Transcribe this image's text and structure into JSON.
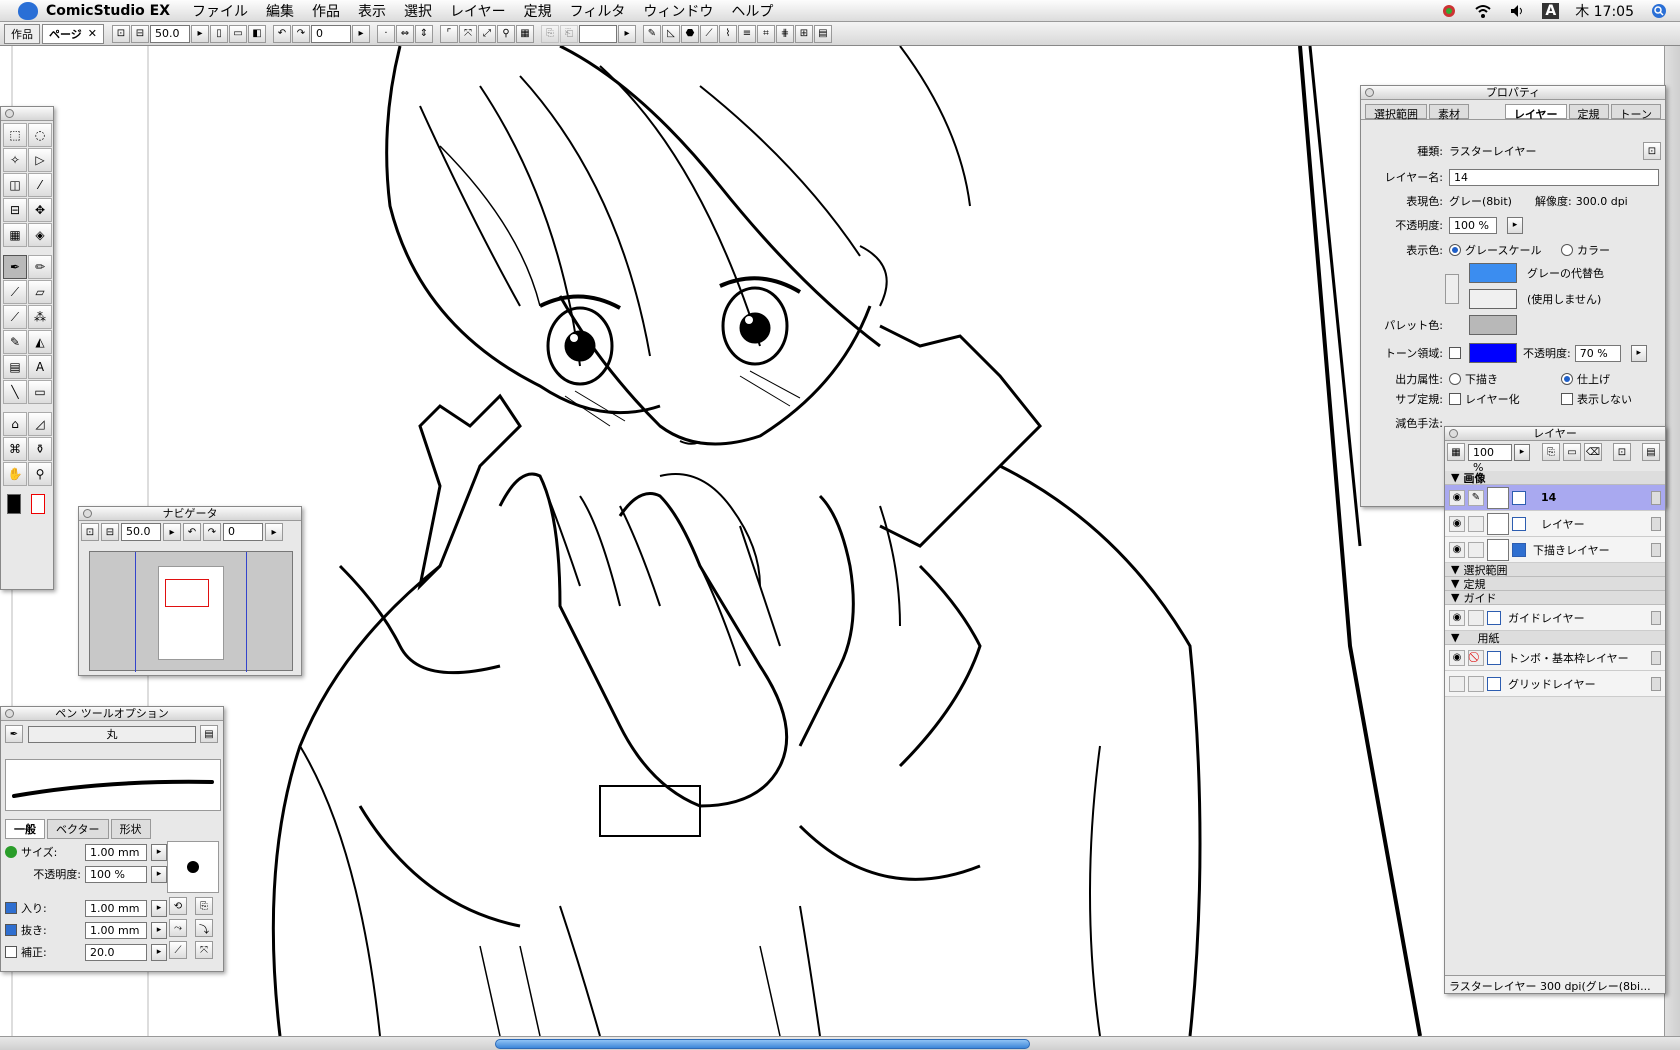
{
  "menubar": {
    "app_name": "ComicStudio EX",
    "items": [
      "ファイル",
      "編集",
      "作品",
      "表示",
      "選択",
      "レイヤー",
      "定規",
      "フィルタ",
      "ウィンドウ",
      "ヘルプ"
    ],
    "clock": "木 17:05",
    "ime": "A"
  },
  "toolbar": {
    "tab_work": "作品",
    "tab_page": "ページ",
    "tab_close": "✕",
    "zoom": "50.0",
    "angle": "0"
  },
  "toolbox": {
    "tools": [
      "marquee",
      "lasso",
      "magic-wand",
      "object-select",
      "layer-select",
      "eyedropper",
      "layer-move",
      "move",
      "ruler",
      "3d",
      "pen",
      "pencil",
      "marker",
      "eraser",
      "brush",
      "airbrush",
      "pen-fill",
      "paint-bucket",
      "gradation",
      "text",
      "line",
      "rectangle",
      "pattern",
      "tone",
      "texture",
      "stamp",
      "hand",
      "zoom"
    ]
  },
  "navigator": {
    "title": "ナビゲータ",
    "zoom": "50.0",
    "angle": "0"
  },
  "pen_options": {
    "title": "ペン ツールオプション",
    "brush_name": "丸",
    "tabs": [
      "一般",
      "ベクター",
      "形状"
    ],
    "size_label": "サイズ:",
    "size": "1.00 mm",
    "opacity_label": "不透明度:",
    "opacity": "100 %",
    "in_label": "入り:",
    "in_value": "1.00 mm",
    "out_label": "抜き:",
    "out_value": "1.00 mm",
    "correction_label": "補正:",
    "correction": "20.0"
  },
  "properties": {
    "title": "プロパティ",
    "tabs": [
      "選択範囲",
      "素材",
      "レイヤー",
      "定規",
      "トーン"
    ],
    "type_label": "種類:",
    "type": "ラスターレイヤー",
    "name_label": "レイヤー名:",
    "name": "14",
    "expression_label": "表現色:",
    "expression": "グレー(8bit)",
    "resolution_label": "解像度:",
    "resolution": "300.0 dpi",
    "opacity_label": "不透明度:",
    "opacity": "100 %",
    "display_color_label": "表示色:",
    "grayscale": "グレースケール",
    "color": "カラー",
    "gray_substitute": "グレーの代替色",
    "unused": "(使用しません)",
    "palette_label": "パレット色:",
    "tone_area_label": "トーン領域:",
    "tone_opacity_label": "不透明度:",
    "tone_opacity": "70 %",
    "output_label": "出力属性:",
    "draft": "下描き",
    "finish": "仕上げ",
    "sub_ruler_label": "サブ定規:",
    "layerize": "レイヤー化",
    "hide": "表示しない",
    "reduce_label": "減色手法:",
    "colors": {
      "gray_substitute": "#3b8df0",
      "tone_area": "#0000ff",
      "palette": "#b8b8b8"
    }
  },
  "layers": {
    "title": "レイヤー",
    "opacity": "100 %",
    "groups": {
      "image": "画像",
      "selection": "選択範囲",
      "ruler": "定規",
      "guide": "ガイド",
      "paper": "用紙"
    },
    "rows": {
      "l14": "14",
      "layer": "レイヤー",
      "draft": "下描きレイヤー",
      "guide": "ガイドレイヤー",
      "tombo": "トンボ・基本枠レイヤー",
      "grid": "グリッドレイヤー"
    },
    "status": "ラスターレイヤー 300 dpi(グレー(8bi..."
  }
}
